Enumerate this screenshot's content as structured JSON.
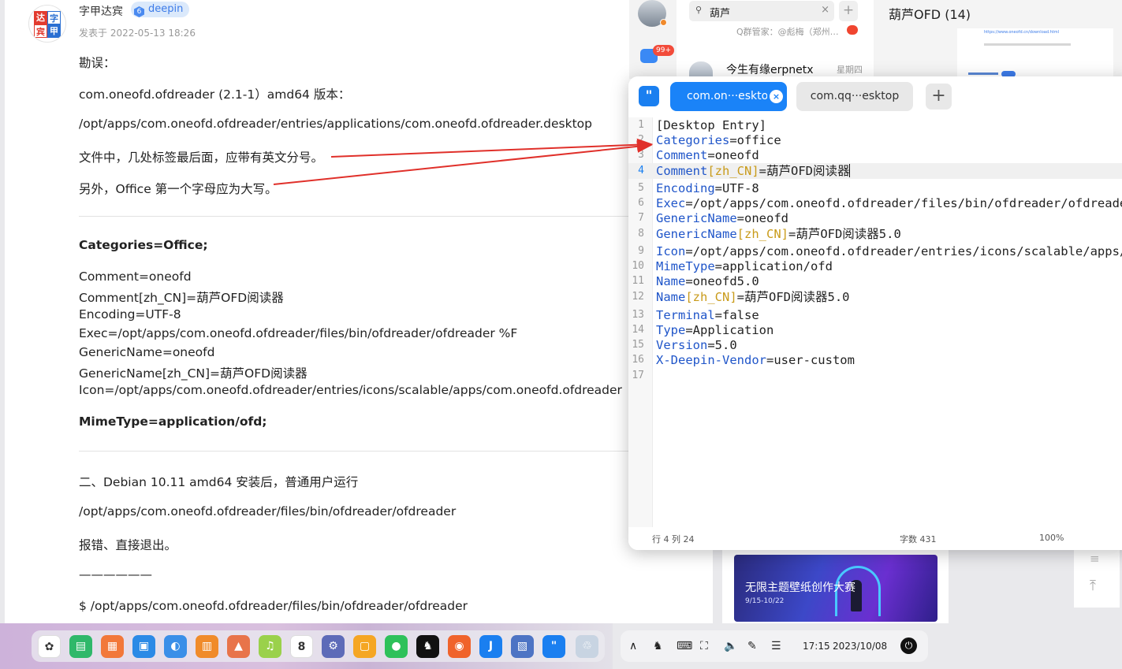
{
  "post": {
    "avatar_chars": [
      "达",
      "字",
      "宾",
      "甲"
    ],
    "author": "字甲达宾",
    "badge_level": "6",
    "badge_label": "deepin",
    "time": "发表于 2022-05-13 18:26",
    "paragraphs": [
      "勘误：",
      "com.oneofd.ofdreader (2.1-1）amd64 版本：",
      "/opt/apps/com.oneofd.ofdreader/entries/applications/com.oneofd.ofdreader.desktop",
      "文件中，几处标签最后面，应带有英文分号。",
      "另外，Office 第一个字母应为大写。"
    ],
    "bold_categories": "Categories=Office;",
    "entries": [
      "Comment=oneofd",
      "Comment[zh_CN]=葫芦OFD阅读器",
      "Encoding=UTF-8",
      "Exec=/opt/apps/com.oneofd.ofdreader/files/bin/ofdreader/ofdreader %F",
      "GenericName=oneofd",
      "GenericName[zh_CN]=葫芦OFD阅读器",
      "Icon=/opt/apps/com.oneofd.ofdreader/entries/icons/scalable/apps/com.oneofd.ofdreader"
    ],
    "bold_mimetype": "MimeType=application/ofd;",
    "section2": [
      "二、Debian 10.11 amd64 安装后，普通用户运行",
      "/opt/apps/com.oneofd.ofdreader/files/bin/ofdreader/ofdreader",
      "报错、直接退出。",
      "——————",
      "$ /opt/apps/com.oneofd.ofdreader/files/bin/ofdreader/ofdreader"
    ]
  },
  "chat": {
    "badge": "99+",
    "search_value": "葫芦",
    "search_clear": "×",
    "add": "+",
    "prev_item_text": "Q群管家：@彪梅（郑州…",
    "item_name": "今生有缘erpnetx",
    "item_time": "星期四",
    "conversation_title": "葫芦OFD (14)",
    "preview_link": "https://www.oneofd.cn/download.html"
  },
  "editor": {
    "logo": "\"",
    "tabs": [
      {
        "label": "com.on···esktop",
        "close": "×"
      },
      {
        "label": "com.qq···esktop"
      }
    ],
    "add_tab": "+",
    "lines": [
      {
        "n": "1",
        "key": "",
        "locale": "",
        "value": "[Desktop Entry]"
      },
      {
        "n": "2",
        "key": "Categories",
        "locale": "",
        "value": "=office"
      },
      {
        "n": "3",
        "key": "Comment",
        "locale": "",
        "value": "=oneofd"
      },
      {
        "n": "4",
        "key": "Comment",
        "locale": "[zh_CN]",
        "value": "=葫芦OFD阅读器"
      },
      {
        "n": "5",
        "key": "Encoding",
        "locale": "",
        "value": "=UTF-8"
      },
      {
        "n": "6",
        "key": "Exec",
        "locale": "",
        "value": "=/opt/apps/com.oneofd.ofdreader/files/bin/ofdreader/ofdreader %F"
      },
      {
        "n": "7",
        "key": "GenericName",
        "locale": "",
        "value": "=oneofd"
      },
      {
        "n": "8",
        "key": "GenericName",
        "locale": "[zh_CN]",
        "value": "=葫芦OFD阅读器5.0"
      },
      {
        "n": "9",
        "key": "Icon",
        "locale": "",
        "value": "=/opt/apps/com.oneofd.ofdreader/entries/icons/scalable/apps/com.oneofd.ofdreader"
      },
      {
        "n": "10",
        "key": "MimeType",
        "locale": "",
        "value": "=application/ofd"
      },
      {
        "n": "11",
        "key": "Name",
        "locale": "",
        "value": "=oneofd5.0"
      },
      {
        "n": "12",
        "key": "Name",
        "locale": "[zh_CN]",
        "value": "=葫芦OFD阅读器5.0"
      },
      {
        "n": "13",
        "key": "Terminal",
        "locale": "",
        "value": "=false"
      },
      {
        "n": "14",
        "key": "Type",
        "locale": "",
        "value": "=Application"
      },
      {
        "n": "15",
        "key": "Version",
        "locale": "",
        "value": "=5.0"
      },
      {
        "n": "16",
        "key": "X-Deepin-Vendor",
        "locale": "",
        "value": "=user-custom"
      },
      {
        "n": "17",
        "key": "",
        "locale": "",
        "value": ""
      }
    ],
    "current_line": "4",
    "status_position": "行 4  列 24",
    "status_count": "字数 431",
    "status_zoom": "100%"
  },
  "banner": {
    "title": "无限主题壁纸创作大赛",
    "dates": "9/15-10/22"
  },
  "dock": {
    "apps": [
      {
        "name": "launcher",
        "color": "#ffffff",
        "glyph": "✿"
      },
      {
        "name": "terminal",
        "color": "#2fb86a",
        "glyph": "▤"
      },
      {
        "name": "app-store",
        "color": "#f2783a",
        "glyph": "▦"
      },
      {
        "name": "file-manager",
        "color": "#2b8ae6",
        "glyph": "▣"
      },
      {
        "name": "browser",
        "color": "#3a8fe8",
        "glyph": "◐"
      },
      {
        "name": "archive",
        "color": "#f08b2a",
        "glyph": "▥"
      },
      {
        "name": "image-viewer",
        "color": "#e8744a",
        "glyph": "▲"
      },
      {
        "name": "music",
        "color": "#9ad14b",
        "glyph": "♫"
      },
      {
        "name": "calendar",
        "color": "#ffffff",
        "glyph": "8"
      },
      {
        "name": "system-settings",
        "color": "#5d6bb8",
        "glyph": "⚙"
      },
      {
        "name": "screenshot",
        "color": "#f5a623",
        "glyph": "▢"
      },
      {
        "name": "wechat",
        "color": "#2ec15a",
        "glyph": "●"
      },
      {
        "name": "qq",
        "color": "#111111",
        "glyph": "♞"
      },
      {
        "name": "firefox",
        "color": "#f0632b",
        "glyph": "◉"
      },
      {
        "name": "dingtalk-like",
        "color": "#1a7ff0",
        "glyph": "J"
      },
      {
        "name": "photos",
        "color": "#4d74c4",
        "glyph": "▧"
      },
      {
        "name": "text-editor",
        "color": "#1a7ff0",
        "glyph": "\""
      },
      {
        "name": "trash",
        "color": "#c8d4e2",
        "glyph": "♲"
      }
    ]
  },
  "tray": {
    "items": [
      {
        "name": "expand-tray",
        "glyph": "∧"
      },
      {
        "name": "qq-tray",
        "glyph": "♞"
      },
      {
        "name": "keyboard",
        "glyph": "⌨"
      },
      {
        "name": "screenshot-tray",
        "glyph": "⛶"
      },
      {
        "name": "volume",
        "glyph": "🔈"
      },
      {
        "name": "bluetooth-pen",
        "glyph": "✎"
      },
      {
        "name": "control-center",
        "glyph": "☰"
      }
    ],
    "time": "17:15",
    "date": "2023/10/08",
    "power": "⏻"
  },
  "colors": {
    "accent": "#1a83f8",
    "key": "#1f55c9",
    "locale": "#c99b1a",
    "arrow": "#e0302a"
  }
}
